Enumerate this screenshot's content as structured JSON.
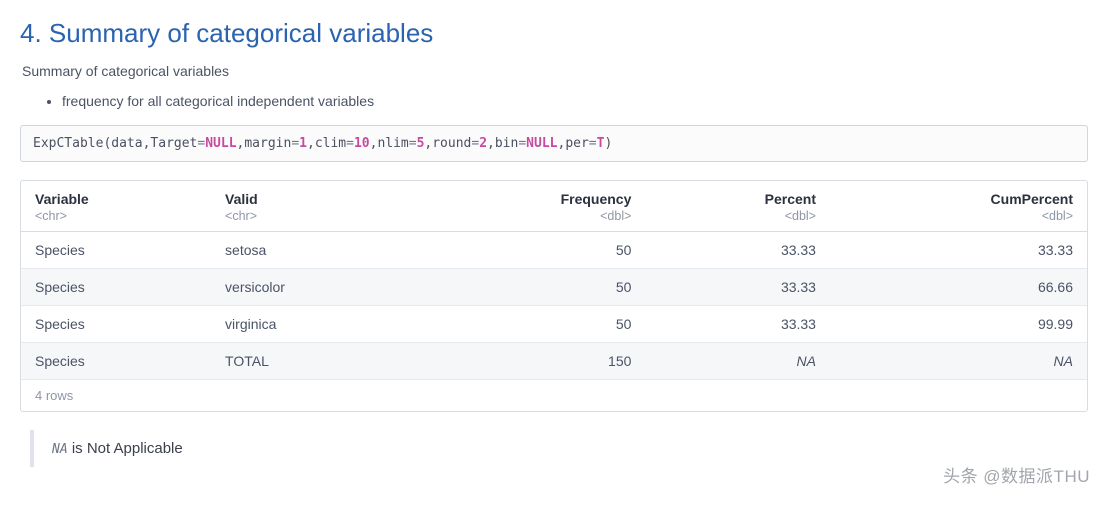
{
  "section": {
    "heading": "4. Summary of categorical variables",
    "subtitle": "Summary of categorical variables",
    "bullet": "frequency for all categorical independent variables"
  },
  "code": {
    "fn": "ExpCTable",
    "open": "(",
    "a0": "data",
    "a1k": "Target",
    "a1v": "NULL",
    "a2k": "margin",
    "a2v": "1",
    "a3k": "clim",
    "a3v": "10",
    "a4k": "nlim",
    "a4v": "5",
    "a5k": "round",
    "a5v": "2",
    "a6k": "bin",
    "a6v": "NULL",
    "a7k": "per",
    "a7v": "T",
    "close": ")",
    "eq": "=",
    "comma": ","
  },
  "table": {
    "headers": {
      "variable": "Variable",
      "valid": "Valid",
      "frequency": "Frequency",
      "percent": "Percent",
      "cumpercent": "CumPercent"
    },
    "types": {
      "variable": "<chr>",
      "valid": "<chr>",
      "frequency": "<dbl>",
      "percent": "<dbl>",
      "cumpercent": "<dbl>"
    },
    "rows": [
      {
        "variable": "Species",
        "valid": "setosa",
        "frequency": "50",
        "percent": "33.33",
        "cumpercent": "33.33"
      },
      {
        "variable": "Species",
        "valid": "versicolor",
        "frequency": "50",
        "percent": "33.33",
        "cumpercent": "66.66"
      },
      {
        "variable": "Species",
        "valid": "virginica",
        "frequency": "50",
        "percent": "33.33",
        "cumpercent": "99.99"
      },
      {
        "variable": "Species",
        "valid": "TOTAL",
        "frequency": "150",
        "percent": "NA",
        "cumpercent": "NA"
      }
    ],
    "row_count_label": "4 rows"
  },
  "legend": {
    "na_code": "NA",
    "na_text": " is Not Applicable"
  },
  "watermark": "头条 @数据派THU"
}
